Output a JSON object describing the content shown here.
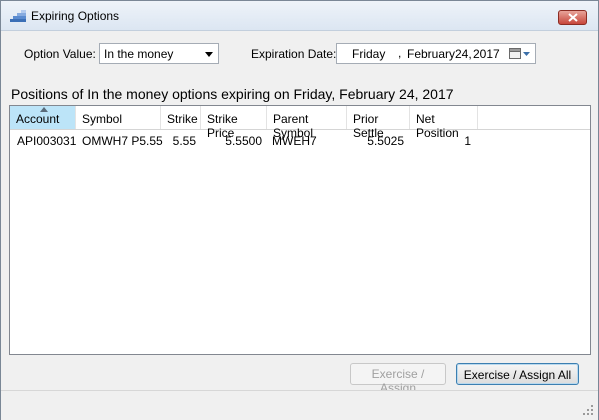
{
  "window": {
    "title": "Expiring Options"
  },
  "filters": {
    "option_value_label": "Option Value:",
    "option_value_selected": "In the money",
    "expiration_label": "Expiration Date:",
    "date_day": "Friday",
    "date_month": "February",
    "date_day_num": "24,",
    "date_year": "2017"
  },
  "heading": "Positions of In the money options expiring on Friday, February 24, 2017",
  "table": {
    "columns": [
      "Account",
      "Symbol",
      "Strike",
      "Strike Price",
      "Parent Symbol",
      "Prior Settle",
      "Net Position"
    ],
    "rows": [
      [
        "API003031",
        "OMWH7 P5.55",
        "5.55",
        "5.5500",
        "MWEH7",
        "5.5025",
        "1"
      ]
    ]
  },
  "buttons": {
    "exercise": "Exercise / Assign",
    "exercise_all": "Exercise / Assign All"
  }
}
